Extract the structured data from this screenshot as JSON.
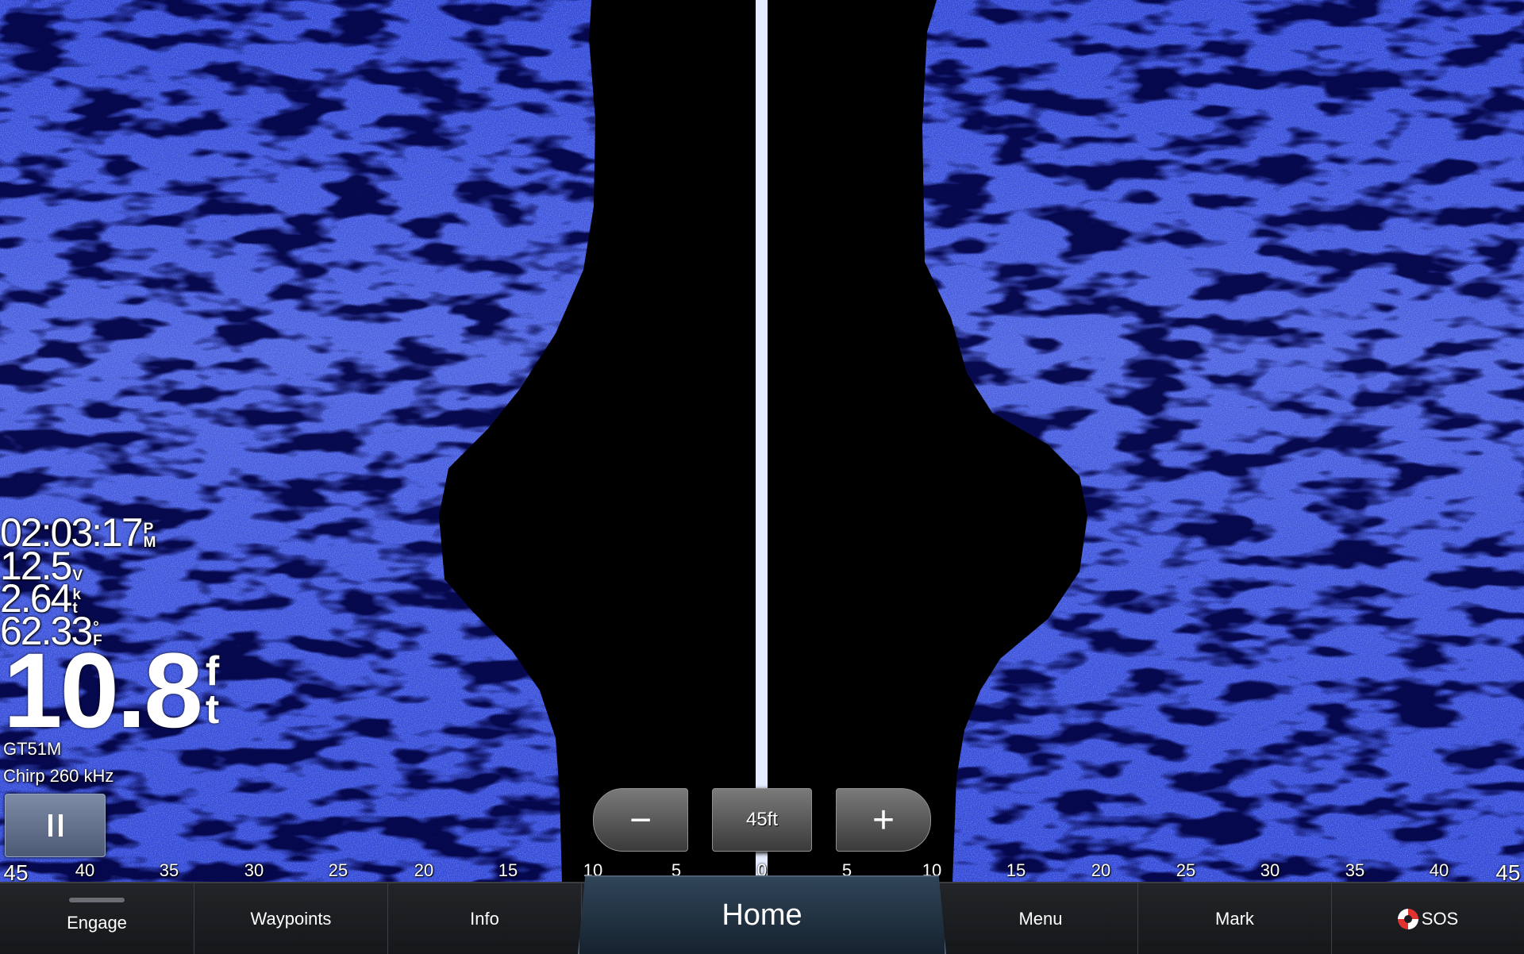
{
  "overlay": {
    "time": "02:03:17",
    "time_unit_top": "P",
    "time_unit_bottom": "M",
    "voltage": "12.5",
    "voltage_unit": "V",
    "speed": "2.64",
    "speed_unit_top": "k",
    "speed_unit_bottom": "t",
    "temperature": "62.33",
    "temperature_unit_top": "°",
    "temperature_unit_bottom": "F",
    "depth": "10.8",
    "depth_unit_top": "f",
    "depth_unit_bottom": "t",
    "transducer": "GT51M",
    "frequency": "Chirp 260 kHz"
  },
  "zoom": {
    "minus_label": "−",
    "range_label": "45ft",
    "plus_label": "+"
  },
  "scale": {
    "ticks": [
      "45",
      "40",
      "35",
      "30",
      "25",
      "20",
      "15",
      "10",
      "5",
      "0",
      "5",
      "10",
      "15",
      "20",
      "25",
      "30",
      "35",
      "40",
      "45"
    ]
  },
  "navbar": {
    "engage": "Engage",
    "waypoints": "Waypoints",
    "info": "Info",
    "home": "Home",
    "menu": "Menu",
    "mark": "Mark",
    "sos": "SOS"
  },
  "colors": {
    "sonar_return": "#3b53e6",
    "sonar_bright": "#7f93ff",
    "water_column": "#000000",
    "nav_home": "#2f4558"
  }
}
